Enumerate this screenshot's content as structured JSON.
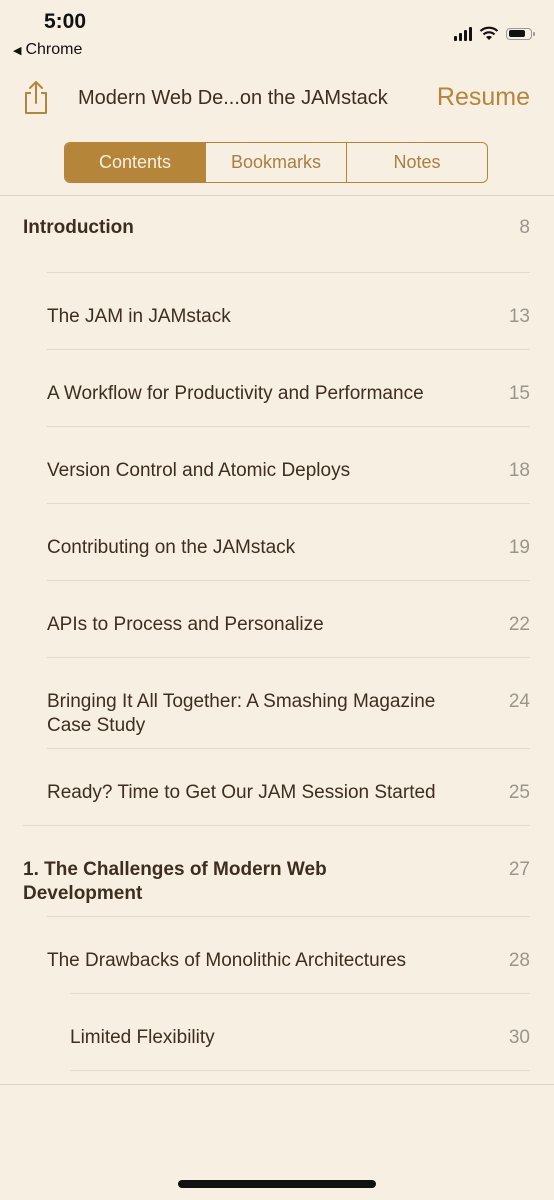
{
  "status_bar": {
    "time": "5:00",
    "back_app": "Chrome"
  },
  "nav": {
    "title": "Modern Web De...on the JAMstack",
    "resume_label": "Resume",
    "share_icon": "share-icon"
  },
  "tabs": [
    {
      "label": "Contents",
      "active": true
    },
    {
      "label": "Bookmarks",
      "active": false
    },
    {
      "label": "Notes",
      "active": false
    }
  ],
  "toc": [
    {
      "level": 0,
      "title": "Introduction",
      "page": "8"
    },
    {
      "level": 1,
      "title": "The JAM in JAMstack",
      "page": "13"
    },
    {
      "level": 1,
      "title": "A Workflow for Productivity and Performance",
      "page": "15"
    },
    {
      "level": 1,
      "title": "Version Control and Atomic Deploys",
      "page": "18"
    },
    {
      "level": 1,
      "title": "Contributing on the JAMstack",
      "page": "19"
    },
    {
      "level": 1,
      "title": "APIs to Process and Personalize",
      "page": "22"
    },
    {
      "level": 1,
      "title": "Bringing It All Together: A Smashing Magazine Case Study",
      "page": "24"
    },
    {
      "level": 1,
      "title": "Ready? Time to Get Our JAM Session Started",
      "page": "25"
    },
    {
      "level": 0,
      "title": "1. The Challenges of Modern Web Development",
      "page": "27"
    },
    {
      "level": 1,
      "title": "The Drawbacks of Monolithic Architectures",
      "page": "28"
    },
    {
      "level": 2,
      "title": "Limited Flexibility",
      "page": "30"
    }
  ],
  "colors": {
    "accent": "#b5863a",
    "background": "#f7efe2",
    "text": "#3d2e1f",
    "page_number": "#9a958d"
  }
}
